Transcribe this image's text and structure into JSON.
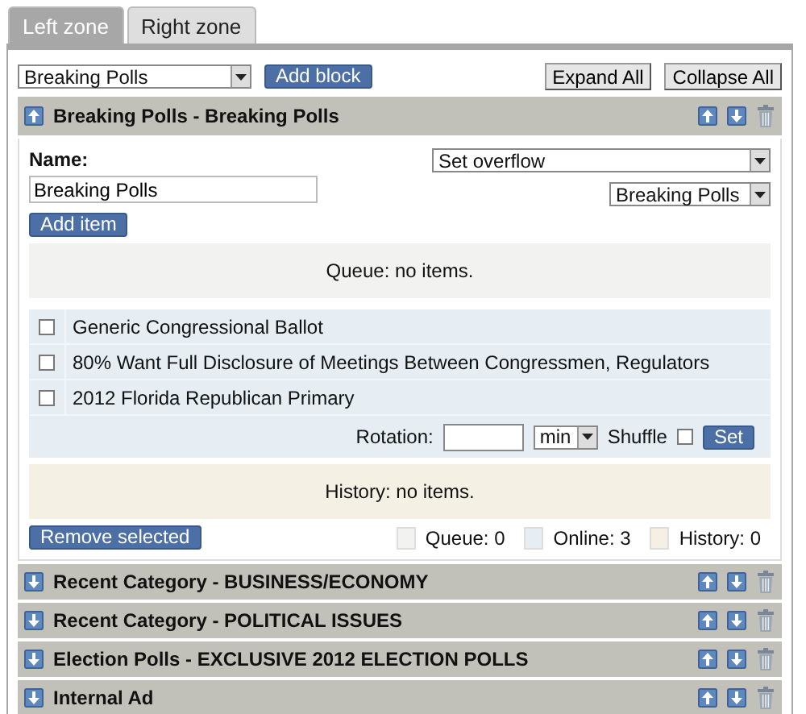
{
  "tabs": [
    {
      "label": "Left zone",
      "selected": true
    },
    {
      "label": "Right zone",
      "selected": false
    }
  ],
  "toolbar": {
    "block_select": "Breaking Polls",
    "add_block": "Add block",
    "expand_all": "Expand All",
    "collapse_all": "Collapse All"
  },
  "blocks": [
    {
      "title": "Breaking Polls - Breaking Polls",
      "expanded": true,
      "detail": {
        "name_label": "Name:",
        "name_value": "Breaking Polls",
        "overflow_select": "Set overflow",
        "overflow_target": "Breaking Polls",
        "add_item": "Add item",
        "queue_message": "Queue: no items.",
        "items": [
          {
            "label": "Generic Congressional Ballot",
            "checked": false
          },
          {
            "label": "80% Want Full Disclosure of Meetings Between Congressmen, Regulators",
            "checked": false
          },
          {
            "label": "2012 Florida Republican Primary",
            "checked": false
          }
        ],
        "rotation": {
          "label": "Rotation:",
          "unit": "min",
          "shuffle_label": "Shuffle",
          "shuffle_checked": false,
          "set": "Set"
        },
        "history_message": "History: no items.",
        "remove_selected": "Remove selected",
        "legend": [
          {
            "label": "Queue: 0",
            "color": "#f2f2f0"
          },
          {
            "label": "Online: 3",
            "color": "#e6eef3"
          },
          {
            "label": "History: 0",
            "color": "#f4f0e4"
          }
        ]
      }
    },
    {
      "title": "Recent Category - BUSINESS/ECONOMY",
      "expanded": false
    },
    {
      "title": "Recent Category - POLITICAL ISSUES",
      "expanded": false
    },
    {
      "title": "Election Polls - EXCLUSIVE 2012 ELECTION POLLS",
      "expanded": false
    },
    {
      "title": "Internal Ad",
      "expanded": false
    }
  ]
}
